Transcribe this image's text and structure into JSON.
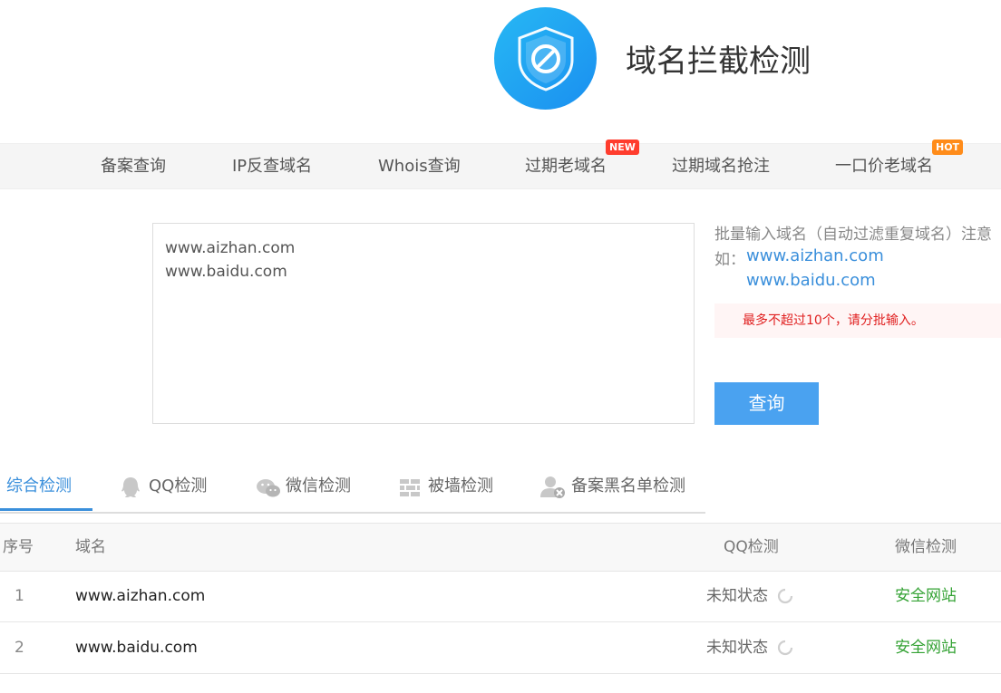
{
  "header": {
    "title": "域名拦截检测",
    "logo_icon": "shield-block-icon"
  },
  "nav": {
    "items": [
      {
        "label": "备案查询"
      },
      {
        "label": "IP反查域名"
      },
      {
        "label": "Whois查询"
      },
      {
        "label": "过期老域名",
        "badge": "NEW"
      },
      {
        "label": "过期域名抢注"
      },
      {
        "label": "一口价老域名",
        "badge": "HOT"
      }
    ]
  },
  "input": {
    "value": "www.aizhan.com\nwww.baidu.com"
  },
  "hint": {
    "text": "批量输入域名（自动过滤重复域名）注意",
    "example_label": "如：",
    "examples": [
      "www.aizhan.com",
      "www.baidu.com"
    ],
    "warning": "最多不超过10个，请分批输入。"
  },
  "query_button": {
    "label": "查询"
  },
  "tabs": [
    {
      "label": "综合检测",
      "icon": "",
      "active": true
    },
    {
      "label": "QQ检测",
      "icon": "qq-icon"
    },
    {
      "label": "微信检测",
      "icon": "wechat-icon"
    },
    {
      "label": "被墙检测",
      "icon": "wall-icon"
    },
    {
      "label": "备案黑名单检测",
      "icon": "user-block-icon"
    }
  ],
  "table": {
    "headers": {
      "idx": "序号",
      "domain": "域名",
      "qq": "QQ检测",
      "wechat": "微信检测"
    },
    "rows": [
      {
        "idx": "1",
        "domain": "www.aizhan.com",
        "qq": "未知状态",
        "wechat": "安全网站"
      },
      {
        "idx": "2",
        "domain": "www.baidu.com",
        "qq": "未知状态",
        "wechat": "安全网站"
      }
    ]
  },
  "colors": {
    "accent": "#3a8fdb",
    "button": "#4aa2f0",
    "safe": "#33a233",
    "warning": "#e02020"
  }
}
